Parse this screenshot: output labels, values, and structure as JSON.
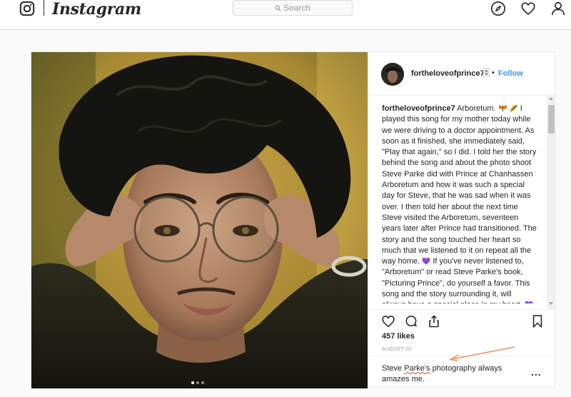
{
  "app": {
    "wordmark": "Instagram"
  },
  "search": {
    "placeholder": "Search"
  },
  "nav": {
    "icons": [
      "compass-icon",
      "heart-icon",
      "profile-icon"
    ]
  },
  "post": {
    "username": "fortheloveofprince7",
    "separator": "•",
    "follow_label": "Follow",
    "caption_user": "fortheloveofprince7",
    "caption": {
      "part1": "Arboretum.",
      "part2": "I played this song for my mother today while we were driving to a doctor appointment. As soon as it finished, she immediately said, \"Play that again,\" so I did. I told her the story behind the song and about the photo shoot Steve Parke did with Prince at Chanhassen Arboretum and how it was such a special day for Steve, that he was sad when it was over. I then told her about the next time Steve visited the Arboretum, seventeen years later after Prince had transitioned. The story and the song touched her heart so much that we listened to it on repeat all the way home.",
      "part3": "If you've never listened to, \"Arboretum\" or read Steve Parke's book, \"Picturing Prince\", do yourself a favor. This song and the story surrounding it, will always have a special place in my heart."
    },
    "likes": "457 likes",
    "date": "AUGUST 20",
    "comment": {
      "pre": "Steve ",
      "underlined": "Parke's",
      "post": " photography always amazes me."
    },
    "more_label": "...",
    "carousel": {
      "count": 3,
      "active": 0
    }
  },
  "colors": {
    "accent": "#3897f0",
    "border": "#dbdbdb",
    "text": "#262626",
    "muted": "#999999",
    "annotation_arrow": "#e8a070"
  }
}
